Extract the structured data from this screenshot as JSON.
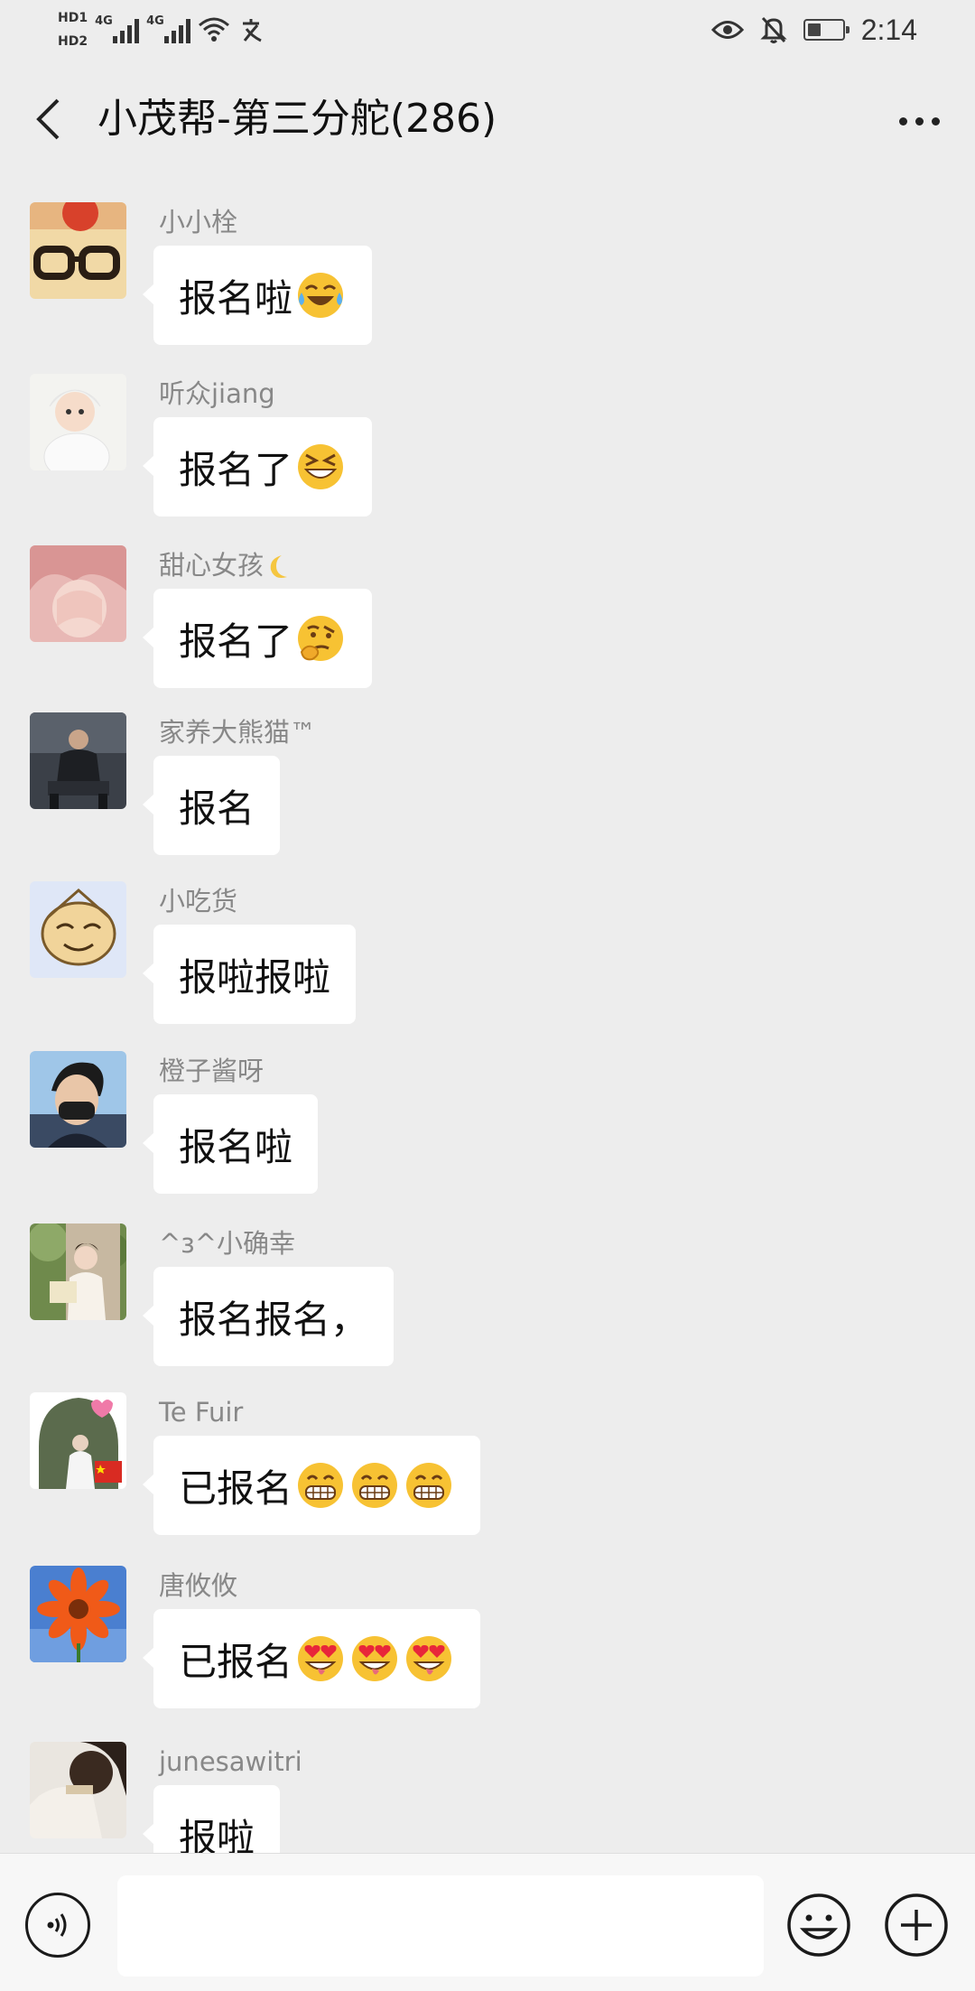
{
  "status_bar": {
    "hd1": "HD1",
    "hd2": "HD2",
    "net1": "4G",
    "net2": "4G",
    "time": "2:14",
    "icons": [
      "hd-icon",
      "signal-icon",
      "wifi-icon",
      "eye-comfort-icon",
      "mute-icon",
      "battery-icon"
    ]
  },
  "header": {
    "title": "小茂帮-第三分舵(286)",
    "back_icon": "chevron-left-icon",
    "more_icon": "more-dots-icon"
  },
  "messages": [
    {
      "sender": "小小栓",
      "text": "报名啦",
      "emoji": [
        "tears-of-joy"
      ]
    },
    {
      "sender": "听众jiang",
      "text": "报名了",
      "emoji": [
        "squinting-grin"
      ]
    },
    {
      "sender": "甜心女孩",
      "sender_suffix_icon": "crescent-moon",
      "text": "报名了",
      "emoji": [
        "thinking-face"
      ]
    },
    {
      "sender": "家养大熊猫™",
      "text": "报名",
      "emoji": []
    },
    {
      "sender": "小吃货",
      "text": "报啦报啦",
      "emoji": []
    },
    {
      "sender": "橙子酱呀",
      "text": "报名啦",
      "emoji": []
    },
    {
      "sender": "^з^小确幸",
      "text": "报名报名，",
      "emoji": []
    },
    {
      "sender": "Te Fuir",
      "text": "已报名",
      "emoji": [
        "grimacing-grin",
        "grimacing-grin",
        "grimacing-grin"
      ]
    },
    {
      "sender": "唐攸攸",
      "text": "已报名",
      "emoji": [
        "heart-eyes-drool",
        "heart-eyes-drool",
        "heart-eyes-drool"
      ]
    },
    {
      "sender": "junesawitri",
      "text": "报啦",
      "emoji": []
    }
  ],
  "input_bar": {
    "voice_icon": "voice-icon",
    "emoji_icon": "emoji-icon",
    "plus_icon": "plus-icon",
    "input_value": ""
  },
  "colors": {
    "background": "#ededed",
    "bubble": "#ffffff",
    "sender_text": "#888888",
    "emoji_yellow": "#f7c233"
  }
}
